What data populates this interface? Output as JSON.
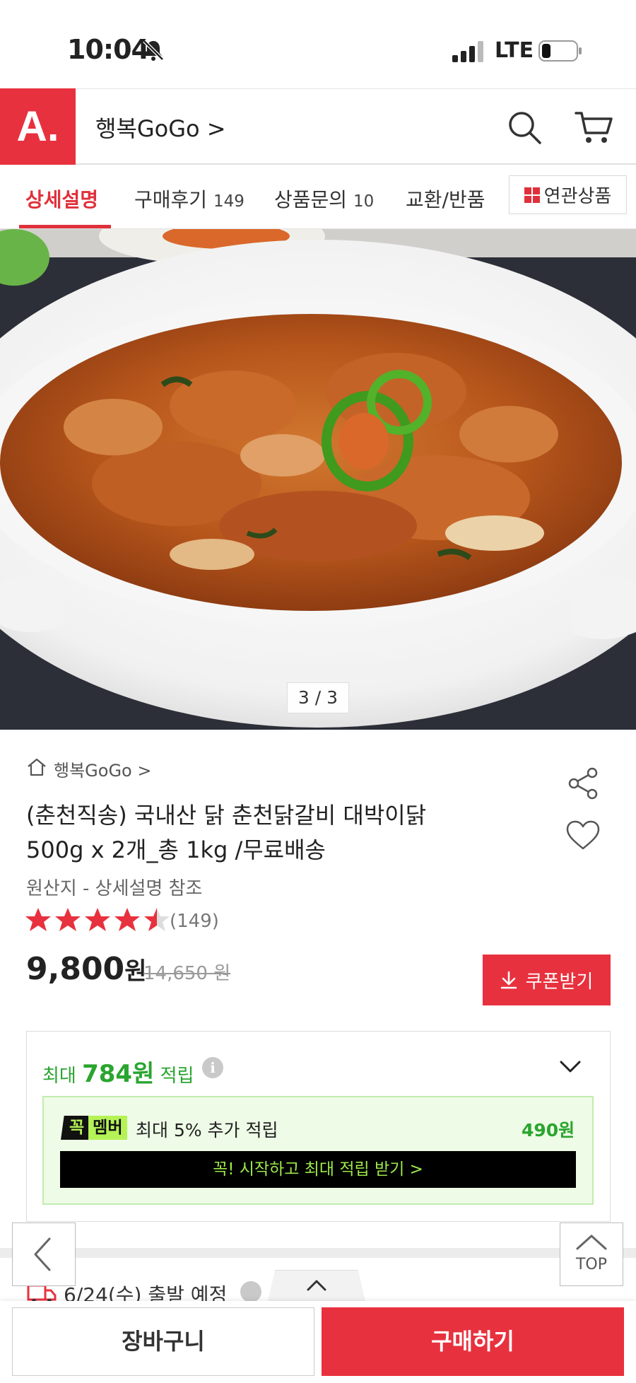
{
  "status_bar": {
    "time": "10:04",
    "network": "LTE"
  },
  "header": {
    "logo": "A.",
    "store_name": "행복GoGo >"
  },
  "tabs": [
    {
      "label": "상세설명",
      "count": ""
    },
    {
      "label": "구매후기",
      "count": "149"
    },
    {
      "label": "상품문의",
      "count": "10"
    },
    {
      "label": "교환/반품",
      "count": ""
    }
  ],
  "related_button": "연관상품",
  "image_counter": "3 / 3",
  "product": {
    "breadcrumb": "행복GoGo >",
    "title_line1": "(춘천직송) 국내산 닭 춘천닭갈비 대박이닭",
    "title_line2": "500g x 2개_총 1kg /무료배송",
    "origin": "원산지 - 상세설명 참조",
    "rating": 4.5,
    "review_count": "(149)",
    "price": "9,800",
    "price_unit": "원",
    "original_price": "14,650 원",
    "coupon_button": "쿠폰받기"
  },
  "points": {
    "prefix": "최대",
    "amount": "784원",
    "suffix": "적립",
    "member_badge_a": "꼭",
    "member_badge_b": "멤버",
    "member_text": "최대 5% 추가 적립",
    "member_amount": "490원",
    "member_cta": "꼭! 시작하고 최대 적립 받기  >"
  },
  "shipping": {
    "text": "6/24(수) 출발 예정"
  },
  "nav": {
    "top_label": "TOP"
  },
  "bottom": {
    "cart": "장바구니",
    "buy": "구매하기"
  },
  "colors": {
    "accent_red": "#e8313e",
    "green": "#2aa52f",
    "lime": "#b4f256"
  }
}
